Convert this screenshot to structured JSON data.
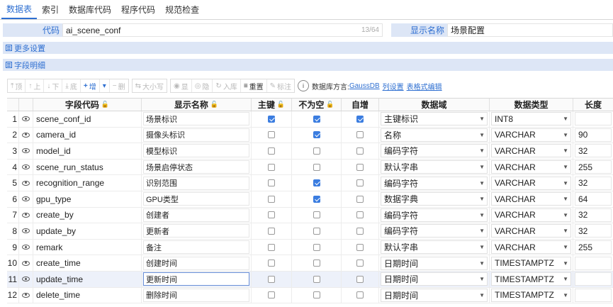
{
  "tabs": [
    {
      "label": "数据表",
      "active": true
    },
    {
      "label": "索引",
      "active": false
    },
    {
      "label": "数据库代码",
      "active": false
    },
    {
      "label": "程序代码",
      "active": false
    },
    {
      "label": "规范检查",
      "active": false
    }
  ],
  "code": {
    "label": "代码",
    "value": "ai_scene_conf",
    "counter": "13/64"
  },
  "display_name": {
    "label": "显示名称",
    "value": "场景配置"
  },
  "sections": {
    "more_settings": "更多设置",
    "field_details": "字段明细"
  },
  "toolbar": {
    "top": "顶",
    "up": "上",
    "down": "下",
    "bottom": "底",
    "add": "增",
    "delete": "删",
    "case": "大小写",
    "show": "显",
    "hide": "隐",
    "import": "入库",
    "reset": "重置",
    "mark": "标注",
    "info": "i",
    "dialect_label": "数据库方言:",
    "dialect_value": "GaussDB",
    "column_settings": "列设置",
    "table_edit": "表格式编辑"
  },
  "columns": {
    "field_code": "字段代码",
    "display_name": "显示名称",
    "primary_key": "主键",
    "not_null": "不为空",
    "auto_increment": "自增",
    "domain": "数据域",
    "data_type": "数据类型",
    "length": "长度"
  },
  "rows": [
    {
      "idx": "1",
      "code": "scene_conf_id",
      "name": "场景标识",
      "pk": true,
      "nn": true,
      "ai": true,
      "domain": "主键标识",
      "type": "INT8",
      "len": ""
    },
    {
      "idx": "2",
      "code": "camera_id",
      "name": "摄像头标识",
      "pk": false,
      "nn": true,
      "ai": false,
      "domain": "名称",
      "type": "VARCHAR",
      "len": "90"
    },
    {
      "idx": "3",
      "code": "model_id",
      "name": "模型标识",
      "pk": false,
      "nn": false,
      "ai": false,
      "domain": "编码字符",
      "type": "VARCHAR",
      "len": "32"
    },
    {
      "idx": "4",
      "code": "scene_run_status",
      "name": "场景启停状态",
      "pk": false,
      "nn": false,
      "ai": false,
      "domain": "默认字串",
      "type": "VARCHAR",
      "len": "255"
    },
    {
      "idx": "5",
      "code": "recognition_range",
      "name": "识别范围",
      "pk": false,
      "nn": true,
      "ai": false,
      "domain": "编码字符",
      "type": "VARCHAR",
      "len": "32"
    },
    {
      "idx": "6",
      "code": "gpu_type",
      "name": "GPU类型",
      "pk": false,
      "nn": true,
      "ai": false,
      "domain": "数据字典",
      "type": "VARCHAR",
      "len": "64"
    },
    {
      "idx": "7",
      "code": "create_by",
      "name": "创建者",
      "pk": false,
      "nn": false,
      "ai": false,
      "domain": "编码字符",
      "type": "VARCHAR",
      "len": "32"
    },
    {
      "idx": "8",
      "code": "update_by",
      "name": "更新者",
      "pk": false,
      "nn": false,
      "ai": false,
      "domain": "编码字符",
      "type": "VARCHAR",
      "len": "32"
    },
    {
      "idx": "9",
      "code": "remark",
      "name": "备注",
      "pk": false,
      "nn": false,
      "ai": false,
      "domain": "默认字串",
      "type": "VARCHAR",
      "len": "255"
    },
    {
      "idx": "10",
      "code": "create_time",
      "name": "创建时间",
      "pk": false,
      "nn": false,
      "ai": false,
      "domain": "日期时间",
      "type": "TIMESTAMPTZ",
      "len": ""
    },
    {
      "idx": "11",
      "code": "update_time",
      "name": "更新时间",
      "pk": false,
      "nn": false,
      "ai": false,
      "domain": "日期时间",
      "type": "TIMESTAMPTZ",
      "len": "",
      "selected": true
    },
    {
      "idx": "12",
      "code": "delete_time",
      "name": "删除时间",
      "pk": false,
      "nn": false,
      "ai": false,
      "domain": "日期时间",
      "type": "TIMESTAMPTZ",
      "len": ""
    }
  ],
  "colors": {
    "accent": "#2e6fd1",
    "label_bg": "#dde6f6",
    "checkbox": "#3b7de0",
    "selected_row": "#edf1fa"
  }
}
